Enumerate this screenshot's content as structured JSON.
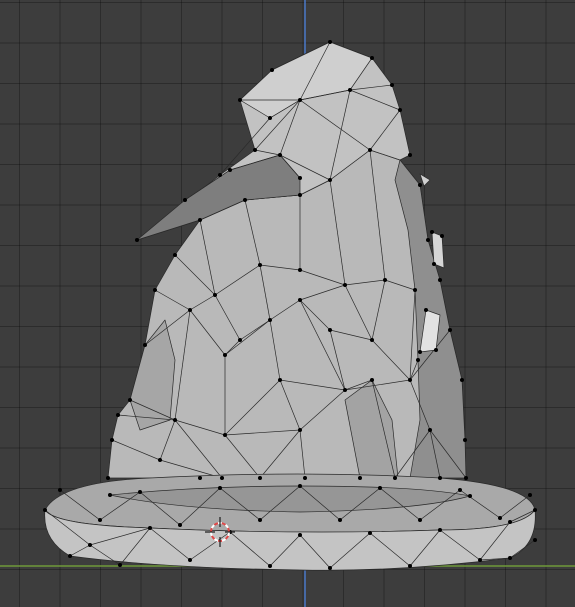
{
  "viewport": {
    "mode": "edit-mode",
    "shading": "solid",
    "object": "wizard-hat-mesh",
    "colors": {
      "background": "#3d3d3d",
      "grid": "#2f2f2f",
      "axis_x": "#6e9a3a",
      "axis_z": "#4a78c8",
      "mesh_face": "#b9b9b9",
      "mesh_shadow": "#8a8a8a",
      "mesh_edge": "#2a2a2a",
      "vertex": "#000000",
      "cursor_red": "#e04848",
      "cursor_white": "#ffffff"
    },
    "icons": [
      "3d-cursor-icon"
    ]
  }
}
